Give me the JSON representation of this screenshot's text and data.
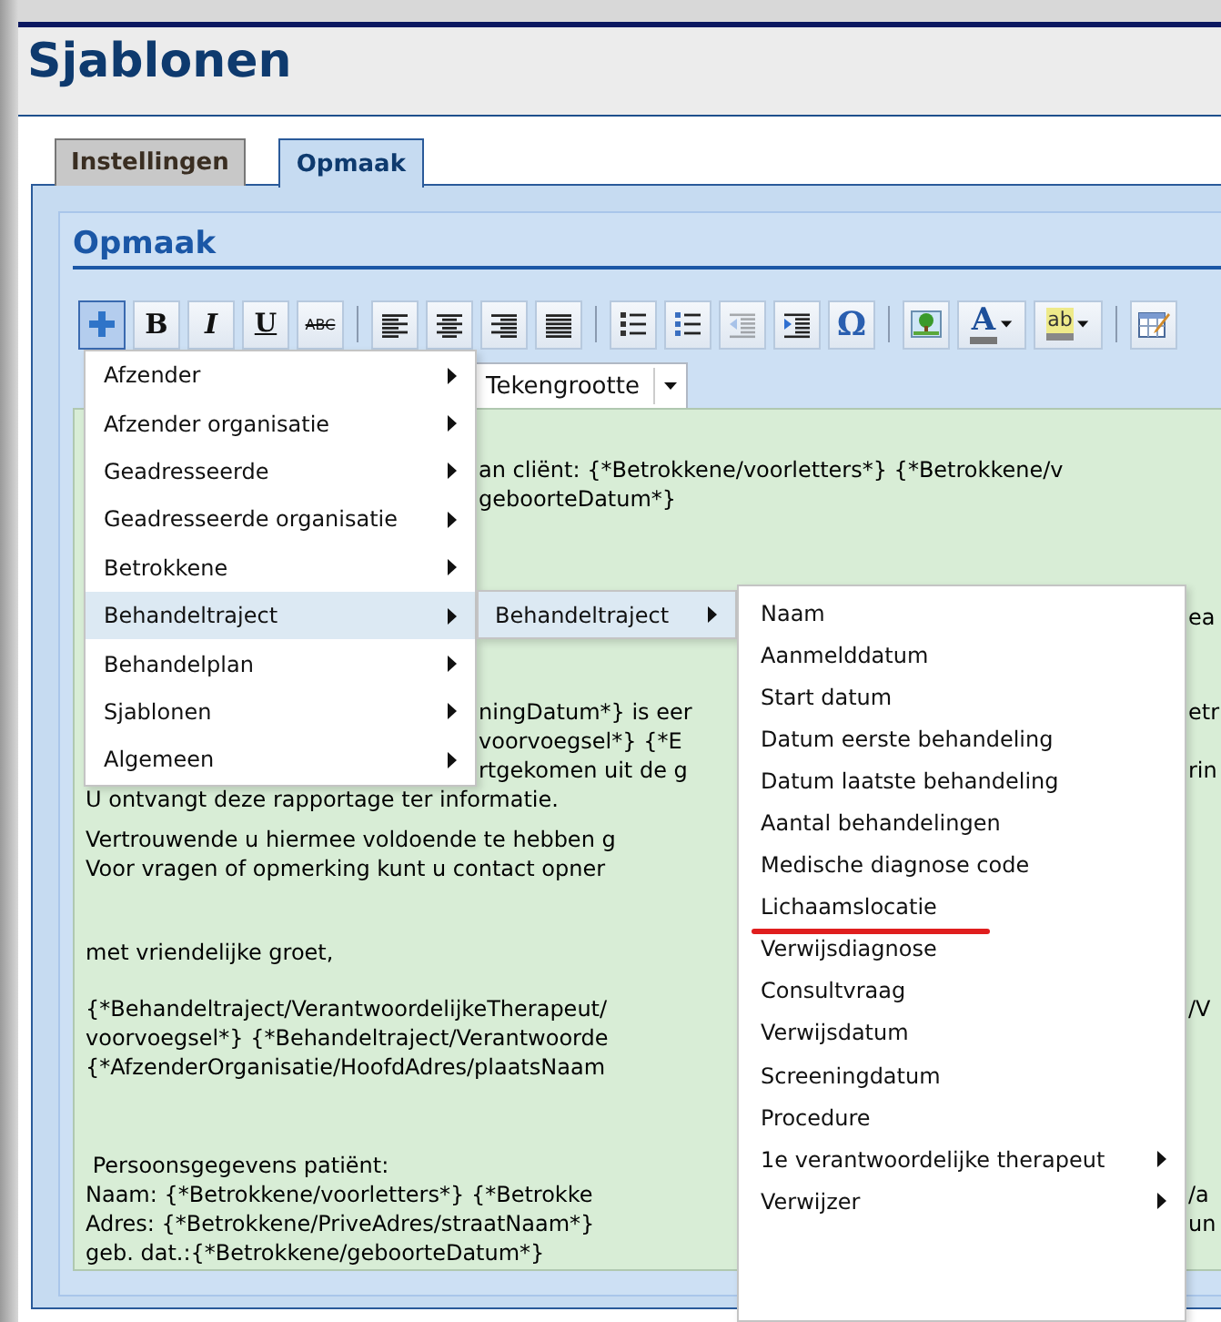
{
  "page": {
    "title": "Sjablonen"
  },
  "tabs": [
    {
      "label": "Instellingen",
      "selected": false
    },
    {
      "label": "Opmaak",
      "selected": true
    }
  ],
  "section": {
    "heading": "Opmaak"
  },
  "toolbar": [
    {
      "kind": "insert",
      "pressed": true,
      "disabled": false
    },
    {
      "kind": "bold",
      "label": "B",
      "pressed": false,
      "disabled": false
    },
    {
      "kind": "italic",
      "label": "I",
      "pressed": false,
      "disabled": false
    },
    {
      "kind": "underline",
      "label": "U",
      "pressed": false,
      "disabled": false
    },
    {
      "kind": "strike",
      "label": "ABC",
      "pressed": false,
      "disabled": false
    },
    {
      "kind": "separator"
    },
    {
      "kind": "align-left",
      "pressed": false,
      "disabled": false
    },
    {
      "kind": "align-center",
      "pressed": false,
      "disabled": false
    },
    {
      "kind": "align-right",
      "pressed": false,
      "disabled": false
    },
    {
      "kind": "justify",
      "pressed": false,
      "disabled": false
    },
    {
      "kind": "separator"
    },
    {
      "kind": "bullets",
      "pressed": false,
      "disabled": false
    },
    {
      "kind": "numbers",
      "pressed": false,
      "disabled": false
    },
    {
      "kind": "outdent",
      "pressed": false,
      "disabled": true
    },
    {
      "kind": "indent",
      "pressed": false,
      "disabled": false
    },
    {
      "kind": "symbol",
      "label": "Ω",
      "pressed": false,
      "disabled": false
    },
    {
      "kind": "separator"
    },
    {
      "kind": "image",
      "pressed": false,
      "disabled": false
    },
    {
      "kind": "font-color",
      "label": "A",
      "pressed": false,
      "disabled": false
    },
    {
      "kind": "highlight",
      "label": "ab",
      "pressed": false,
      "disabled": false
    },
    {
      "kind": "separator"
    },
    {
      "kind": "table",
      "pressed": false,
      "disabled": false
    }
  ],
  "font_size": {
    "value": "Tekengrootte"
  },
  "editor": {
    "paragraphs": [
      {
        "lines": [
          {
            "middle": "an cliënt: {*Betrokkene/voorletters*} {*Betrokkene/v"
          },
          {
            "middle": "geboorteDatum*}"
          }
        ]
      },
      {
        "lines": [
          {
            "right": "ea"
          }
        ]
      },
      {
        "lines": [
          {
            "middle": "ningDatum*} is eer",
            "right": "etr"
          },
          {
            "middle": "voorvoegsel*} {*E"
          },
          {
            "middle": "rtgekomen uit de g",
            "right": "rin"
          },
          {
            "left": "U ontvangt deze rapportage ter informatie."
          }
        ]
      },
      {
        "lines": [
          {
            "left": "Vertrouwende u hiermee voldoende te hebben g"
          },
          {
            "left": "Voor vragen of opmerking kunt u contact opner"
          }
        ]
      },
      {
        "lines": [
          {
            "left": "met vriendelijke groet,"
          }
        ]
      },
      {
        "lines": [
          {
            "left": "{*Behandeltraject/VerantwoordelijkeTherapeut/",
            "right": "/V"
          },
          {
            "left": "voorvoegsel*} {*Behandeltraject/Verantwoorde"
          },
          {
            "left": "{*AfzenderOrganisatie/HoofdAdres/plaatsNaam"
          }
        ]
      },
      {
        "lines": [
          {
            "left": " Persoonsgegevens patiënt:"
          },
          {
            "left": "Naam: {*Betrokkene/voorletters*} {*Betrokke",
            "right": "/a"
          },
          {
            "left": "Adres: {*Betrokkene/PriveAdres/straatNaam*}",
            "right": "un"
          },
          {
            "left": "geb. dat.:{*Betrokkene/geboorteDatum*}"
          }
        ]
      }
    ]
  },
  "insert_menu": {
    "items": [
      {
        "label": "Afzender",
        "has_submenu": true,
        "selected": false
      },
      {
        "label": "Afzender organisatie",
        "has_submenu": true,
        "selected": false
      },
      {
        "label": "Geadresseerde",
        "has_submenu": true,
        "selected": false
      },
      {
        "label": "Geadresseerde organisatie",
        "has_submenu": true,
        "selected": false
      },
      {
        "label": "Betrokkene",
        "has_submenu": true,
        "selected": false
      },
      {
        "label": "Behandeltraject",
        "has_submenu": true,
        "selected": true
      },
      {
        "label": "Behandelplan",
        "has_submenu": true,
        "selected": false
      },
      {
        "label": "Sjablonen",
        "has_submenu": true,
        "selected": false
      },
      {
        "label": "Algemeen",
        "has_submenu": true,
        "selected": false
      }
    ]
  },
  "submenu": {
    "items": [
      {
        "label": "Behandeltraject",
        "has_submenu": true,
        "selected": true
      }
    ]
  },
  "field_menu": {
    "items": [
      {
        "label": "Naam",
        "has_submenu": false,
        "marked": false
      },
      {
        "label": "Aanmelddatum",
        "has_submenu": false,
        "marked": false
      },
      {
        "label": "Start datum",
        "has_submenu": false,
        "marked": false
      },
      {
        "label": "Datum eerste behandeling",
        "has_submenu": false,
        "marked": false
      },
      {
        "label": "Datum laatste behandeling",
        "has_submenu": false,
        "marked": false
      },
      {
        "label": "Aantal behandelingen",
        "has_submenu": false,
        "marked": false
      },
      {
        "label": "Medische diagnose code",
        "has_submenu": false,
        "marked": false
      },
      {
        "label": "Lichaamslocatie",
        "has_submenu": false,
        "marked": true
      },
      {
        "label": "Verwijsdiagnose",
        "has_submenu": false,
        "marked": false
      },
      {
        "label": "Consultvraag",
        "has_submenu": false,
        "marked": false
      },
      {
        "label": "Verwijsdatum",
        "has_submenu": false,
        "marked": false
      },
      {
        "label": "Screeningdatum",
        "has_submenu": false,
        "marked": false
      },
      {
        "label": "Procedure",
        "has_submenu": false,
        "marked": false
      },
      {
        "label": "1e verantwoordelijke therapeut",
        "has_submenu": true,
        "marked": false
      },
      {
        "label": "Verwijzer",
        "has_submenu": true,
        "marked": false
      }
    ]
  }
}
